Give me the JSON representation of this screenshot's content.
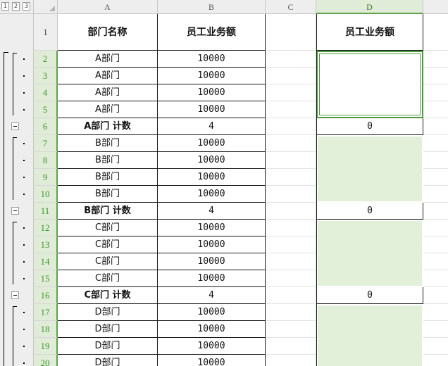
{
  "outline_levels": [
    "1",
    "2",
    "3"
  ],
  "columns": [
    "A",
    "B",
    "C",
    "D"
  ],
  "rows": [
    {
      "num": "1",
      "a": "部门名称",
      "b": "员工业务额",
      "d": "员工业务额",
      "kind": "header"
    },
    {
      "num": "2",
      "a": "A部门",
      "b": "10000",
      "d": "",
      "kind": "data"
    },
    {
      "num": "3",
      "a": "A部门",
      "b": "10000",
      "d": "",
      "kind": "data"
    },
    {
      "num": "4",
      "a": "A部门",
      "b": "10000",
      "d": "",
      "kind": "data"
    },
    {
      "num": "5",
      "a": "A部门",
      "b": "10000",
      "d": "",
      "kind": "data"
    },
    {
      "num": "6",
      "a": "A部门  计数",
      "b": "4",
      "d": "0",
      "kind": "summary"
    },
    {
      "num": "7",
      "a": "B部门",
      "b": "10000",
      "d": "",
      "kind": "data"
    },
    {
      "num": "8",
      "a": "B部门",
      "b": "10000",
      "d": "",
      "kind": "data"
    },
    {
      "num": "9",
      "a": "B部门",
      "b": "10000",
      "d": "",
      "kind": "data"
    },
    {
      "num": "10",
      "a": "B部门",
      "b": "10000",
      "d": "",
      "kind": "data"
    },
    {
      "num": "11",
      "a": "B部门  计数",
      "b": "4",
      "d": "0",
      "kind": "summary"
    },
    {
      "num": "12",
      "a": "C部门",
      "b": "10000",
      "d": "",
      "kind": "data"
    },
    {
      "num": "13",
      "a": "C部门",
      "b": "10000",
      "d": "",
      "kind": "data"
    },
    {
      "num": "14",
      "a": "C部门",
      "b": "10000",
      "d": "",
      "kind": "data"
    },
    {
      "num": "15",
      "a": "C部门",
      "b": "10000",
      "d": "",
      "kind": "data"
    },
    {
      "num": "16",
      "a": "C部门  计数",
      "b": "4",
      "d": "0",
      "kind": "summary"
    },
    {
      "num": "17",
      "a": "D部门",
      "b": "10000",
      "d": "",
      "kind": "data"
    },
    {
      "num": "18",
      "a": "D部门",
      "b": "10000",
      "d": "",
      "kind": "data"
    },
    {
      "num": "19",
      "a": "D部门",
      "b": "10000",
      "d": "",
      "kind": "data"
    },
    {
      "num": "20",
      "a": "D部门",
      "b": "10000",
      "d": "",
      "kind": "data"
    }
  ],
  "colors": {
    "selection": "#4a9a3a",
    "fill": "#e2f0d9",
    "header_bg": "#eeeeee"
  }
}
